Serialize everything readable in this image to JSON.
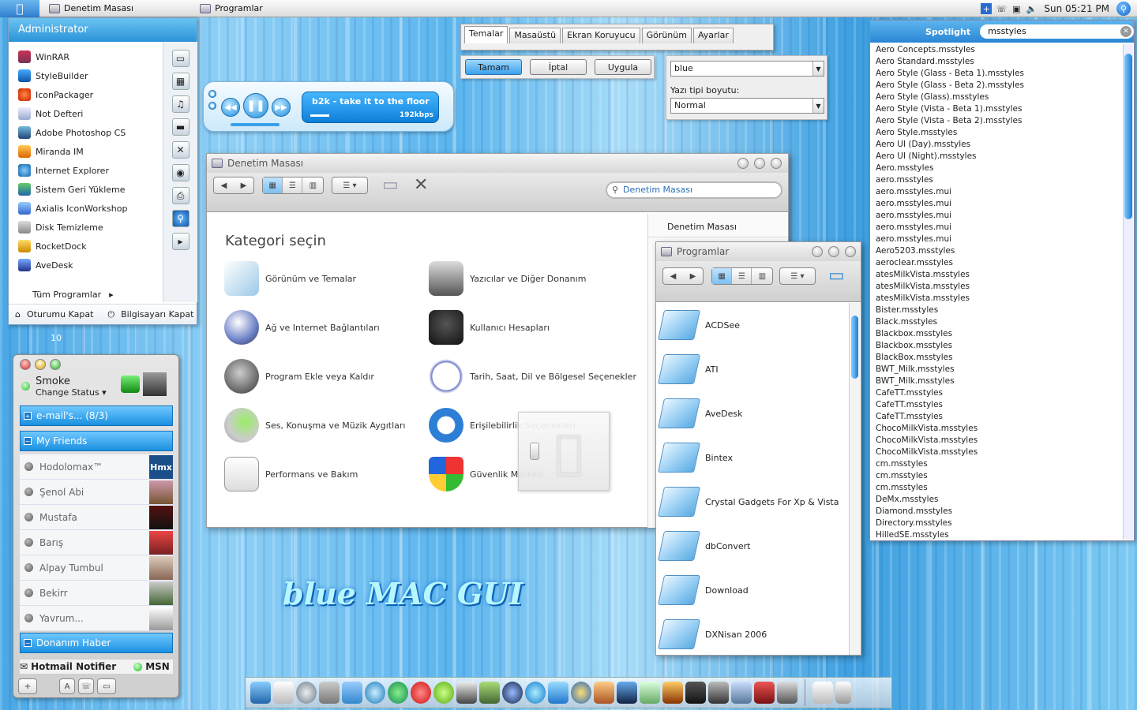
{
  "menubar": {
    "tasks": [
      "Denetim Masası",
      "Programlar"
    ],
    "clock": "Sun 05:21 PM"
  },
  "startmenu": {
    "user": "Administrator",
    "items": [
      "WinRAR",
      "StyleBuilder",
      "IconPackager",
      "Not Defteri",
      "Adobe Photoshop CS",
      "Miranda IM",
      "Internet Explorer",
      "Sistem Geri Yükleme",
      "Axialis IconWorkshop",
      "Disk Temizleme",
      "RocketDock",
      "AveDesk"
    ],
    "all_programs": "Tüm Programlar",
    "logoff": "Oturumu Kapat",
    "shutdown": "Bilgisayarı Kapat",
    "badge": "10"
  },
  "tabs": [
    "Temalar",
    "Masaüstü",
    "Ekran Koruyucu",
    "Görünüm",
    "Ayarlar"
  ],
  "buttons": {
    "ok": "Tamam",
    "cancel": "İptal",
    "apply": "Uygula"
  },
  "fontpanel": {
    "scheme": "blue",
    "size_label": "Yazı tipi boyutu:",
    "size": "Normal"
  },
  "player": {
    "track": "b2k - take it to the floor",
    "bitrate": "192kbps"
  },
  "controlpanel": {
    "title": "Denetim Masası",
    "search": "Denetim Masası",
    "heading": "Kategori seçin",
    "side": "Denetim Masası",
    "categories": [
      "Görünüm ve Temalar",
      "Yazıcılar ve Diğer Donanım",
      "Ağ ve Internet Bağlantıları",
      "Kullanıcı Hesapları",
      "Program Ekle veya Kaldır",
      "Tarih, Saat, Dil ve Bölgesel Seçenekler",
      "Ses, Konuşma ve Müzik Aygıtları",
      "Erişilebilirlik Seçenekleri",
      "Performans ve Bakım",
      "Güvenlik Merkezi"
    ]
  },
  "programs": {
    "title": "Programlar",
    "folders": [
      "ACDSee",
      "ATI",
      "AveDesk",
      "Bintex",
      "Crystal Gadgets For Xp & Vista",
      "dbConvert",
      "Download",
      "DXNisan 2006"
    ]
  },
  "spotlight": {
    "label": "Spotlight",
    "query": "msstyles",
    "results": [
      "Aero Concepts.msstyles",
      "Aero Standard.msstyles",
      "Aero Style (Glass - Beta 1).msstyles",
      "Aero Style (Glass - Beta 2).msstyles",
      "Aero Style (Glass).msstyles",
      "Aero Style (Vista - Beta 1).msstyles",
      "Aero Style (Vista - Beta 2).msstyles",
      "Aero Style.msstyles",
      "Aero UI (Day).msstyles",
      "Aero UI (Night).msstyles",
      "Aero.msstyles",
      "aero.msstyles",
      "aero.msstyles.mui",
      "aero.msstyles.mui",
      "aero.msstyles.mui",
      "aero.msstyles.mui",
      "aero.msstyles.mui",
      "Aero5203.msstyles",
      "aeroclear.msstyles",
      "atesMilkVista.msstyles",
      "atesMilkVista.msstyles",
      "atesMilkVista.msstyles",
      "Bister.msstyles",
      "Black.msstyles",
      "Blackbox.msstyles",
      "Blackbox.msstyles",
      "BlackBox.msstyles",
      "BWT_Milk.msstyles",
      "BWT_Milk.msstyles",
      "CafeTT.msstyles",
      "CafeTT.msstyles",
      "CafeTT.msstyles",
      "ChocoMilkVista.msstyles",
      "ChocoMilkVista.msstyles",
      "ChocoMilkVista.msstyles",
      "cm.msstyles",
      "cm.msstyles",
      "cm.msstyles",
      "DeMx.msstyles",
      "Diamond.msstyles",
      "Directory.msstyles",
      "HilledSE.msstyles"
    ]
  },
  "messenger": {
    "name": "Smoke",
    "status": "Change Status ▾",
    "groups": [
      "e-mail's... (8/3)",
      "My Friends",
      "Donanım Haber"
    ],
    "contacts": [
      "Hodolomax™",
      "Şenol Abi",
      "Mustafa",
      "Barış",
      "Alpay Tumbul",
      "Bekirr",
      "Yavrum..."
    ],
    "footer_left": "Hotmail Notifier",
    "footer_right": "MSN",
    "avatar1": "Hmx"
  },
  "watermark": "blue MAC GUI",
  "colors": {
    "accent": "#2a94d8",
    "selection": "#1a90e0"
  }
}
